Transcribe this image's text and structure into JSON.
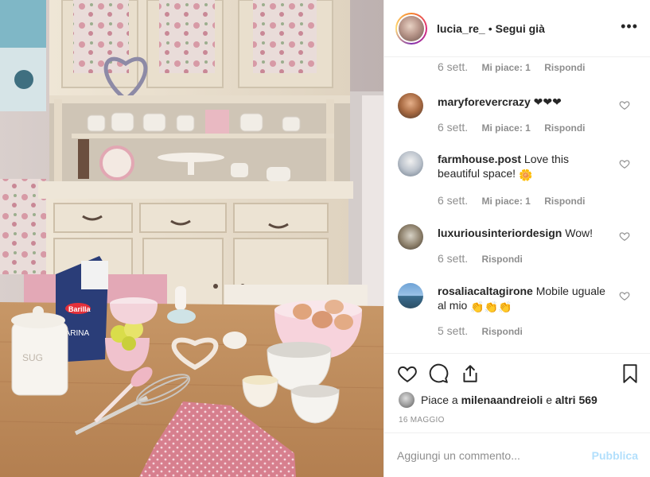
{
  "header": {
    "username": "lucia_re_",
    "separator": "•",
    "follow_status": "Segui già",
    "more": "•••"
  },
  "comments": [
    {
      "text": "",
      "time": "6 sett.",
      "likes": "Mi piace: 1",
      "reply": "Rispondi"
    },
    {
      "username": "maryforevercrazy",
      "text": "❤❤❤",
      "time": "6 sett.",
      "likes": "Mi piace: 1",
      "reply": "Rispondi"
    },
    {
      "username": "farmhouse.post",
      "text": "Love this beautiful space!",
      "emoji": "🌼",
      "time": "6 sett.",
      "likes": "Mi piace: 1",
      "reply": "Rispondi"
    },
    {
      "username": "luxuriousinteriordesign",
      "text": "Wow!",
      "time": "6 sett.",
      "reply": "Rispondi"
    },
    {
      "username": "rosaliacaltagirone",
      "text": "Mobile uguale al mio",
      "emoji": "👏👏👏",
      "time": "5 sett.",
      "reply": "Rispondi"
    }
  ],
  "likes_line": {
    "prefix": "Piace a",
    "user": "milenaandreioli",
    "middle": "e",
    "others": "altri 569"
  },
  "date": "16 MAGGIO",
  "add_comment": {
    "placeholder": "Aggiungi un commento...",
    "publish": "Pubblica"
  },
  "photo": {
    "bag_brand": "Barilla",
    "bag_label": "FARINA",
    "canister_label": "SUG"
  },
  "colors": {
    "text": "#262626",
    "secondary": "#8e8e8e",
    "divider": "#efefef",
    "publish_disabled": "#b2dffc"
  }
}
